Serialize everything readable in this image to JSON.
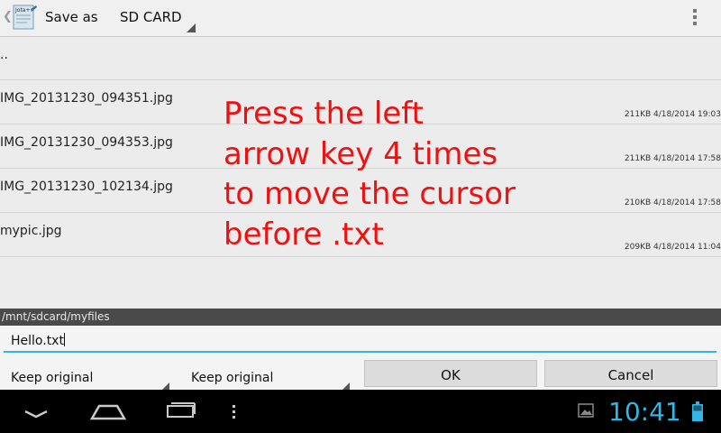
{
  "actionbar": {
    "title": "Save as",
    "location": "SD CARD",
    "app_icon_text": "Jota+"
  },
  "files": [
    {
      "name": "..",
      "size": "",
      "date": ""
    },
    {
      "name": "IMG_20131230_094351.jpg",
      "size": "211KB",
      "date": "4/18/2014 19:03"
    },
    {
      "name": "IMG_20131230_094353.jpg",
      "size": "211KB",
      "date": "4/18/2014 17:58"
    },
    {
      "name": "IMG_20131230_102134.jpg",
      "size": "210KB",
      "date": "4/18/2014 17:58"
    },
    {
      "name": "mypic.jpg",
      "size": "209KB",
      "date": "4/18/2014 11:04"
    }
  ],
  "overlay": {
    "text": "Press the left\narrow key 4 times\nto move the cursor\nbefore .txt"
  },
  "path": "/mnt/sdcard/myfiles",
  "filename": "Hello.txt",
  "options": {
    "dropdown1": "Keep original",
    "dropdown2": "Keep original"
  },
  "buttons": {
    "ok": "OK",
    "cancel": "Cancel"
  },
  "status": {
    "time": "10:41"
  },
  "colors": {
    "accent": "#33b5e5",
    "overlay": "#ee1111"
  }
}
